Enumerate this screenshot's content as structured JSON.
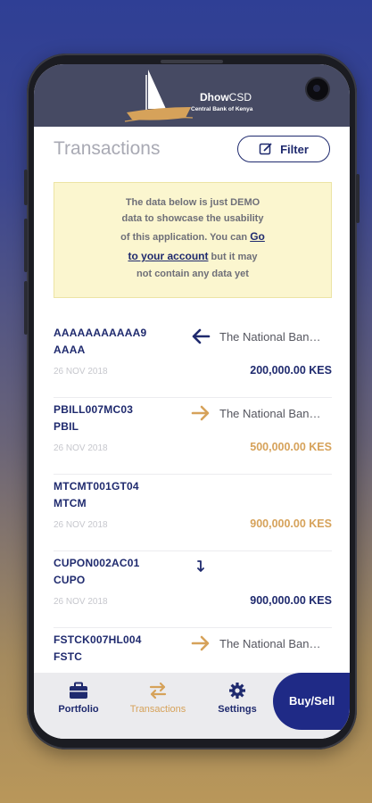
{
  "app": {
    "brand_name_bold": "Dhow",
    "brand_name_light": "CSD",
    "brand_subtitle": "Central Bank of Kenya"
  },
  "page": {
    "title": "Transactions",
    "filter_label": "Filter"
  },
  "notice": {
    "line1": "The data below is just DEMO",
    "line2": "data to showcase the usability",
    "line3_prefix": "of this application. You can ",
    "link_part1": "Go",
    "link_part2": "to your account",
    "line4_suffix": " but it may",
    "line5": "not contain any data yet"
  },
  "colors": {
    "incoming": "#1f2a6e",
    "outgoing": "#d6a25a"
  },
  "transactions": [
    {
      "ref_line1": "AAAAAAAAAAA9",
      "ref_line2": "AAAA",
      "direction": "incoming",
      "arrow_icon": "arrow-left-icon",
      "counterparty": "The National Ban…",
      "date": "26 NOV 2018",
      "amount": "200,000.00 KES"
    },
    {
      "ref_line1": "PBILL007MC03",
      "ref_line2": "PBIL",
      "direction": "outgoing",
      "arrow_icon": "arrow-right-icon",
      "counterparty": "The National Ban…",
      "date": "26 NOV 2018",
      "amount": "500,000.00 KES"
    },
    {
      "ref_line1": "MTCMT001GT04",
      "ref_line2": "MTCM",
      "direction": "outgoing",
      "arrow_icon": "none",
      "counterparty": "",
      "date": "26 NOV 2018",
      "amount": "900,000.00 KES"
    },
    {
      "ref_line1": "CUPON002AC01",
      "ref_line2": "CUPO",
      "direction": "incoming",
      "arrow_icon": "return-arrow-icon",
      "counterparty": "",
      "date": "26 NOV 2018",
      "amount": "900,000.00 KES"
    },
    {
      "ref_line1": "FSTCK007HL004",
      "ref_line2": "FSTC",
      "direction": "outgoing",
      "arrow_icon": "arrow-right-icon",
      "counterparty": "The National Ban…",
      "date": "",
      "amount": ""
    }
  ],
  "nav": {
    "portfolio": "Portfolio",
    "transactions": "Transactions",
    "settings": "Settings",
    "buy_sell": "Buy/Sell",
    "active_color": "#d6a25a",
    "inactive_color": "#1f2a6e"
  }
}
